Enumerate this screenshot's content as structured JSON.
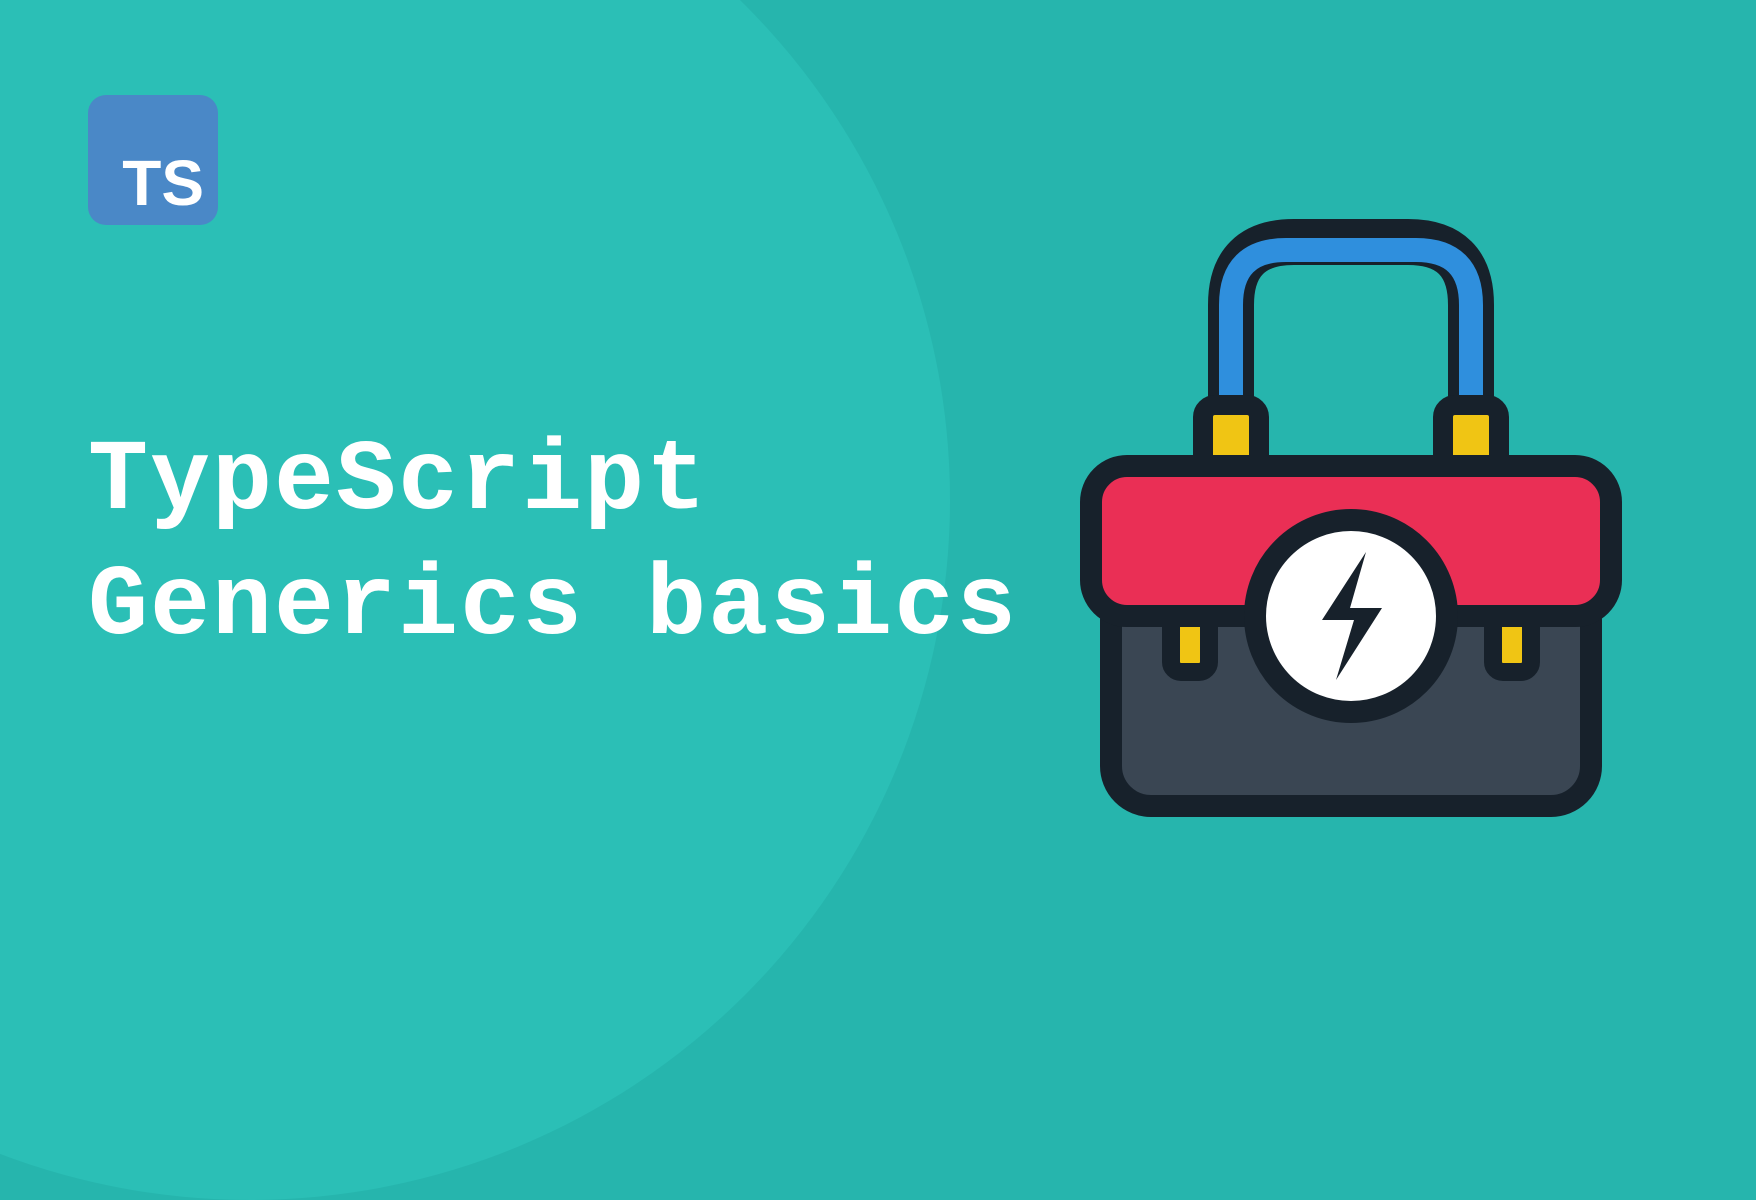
{
  "badge": {
    "label": "TS"
  },
  "title": {
    "line1": "TypeScript",
    "line2": "Generics basics"
  },
  "colors": {
    "bg": "#26b5ad",
    "bgLight": "#2bbfb6",
    "badge": "#4a88c7",
    "stroke": "#17212b",
    "handleBlue": "#2f8fdd",
    "yellow": "#f0c514",
    "red": "#ea2f55",
    "darkBody": "#3a4653",
    "white": "#ffffff"
  }
}
